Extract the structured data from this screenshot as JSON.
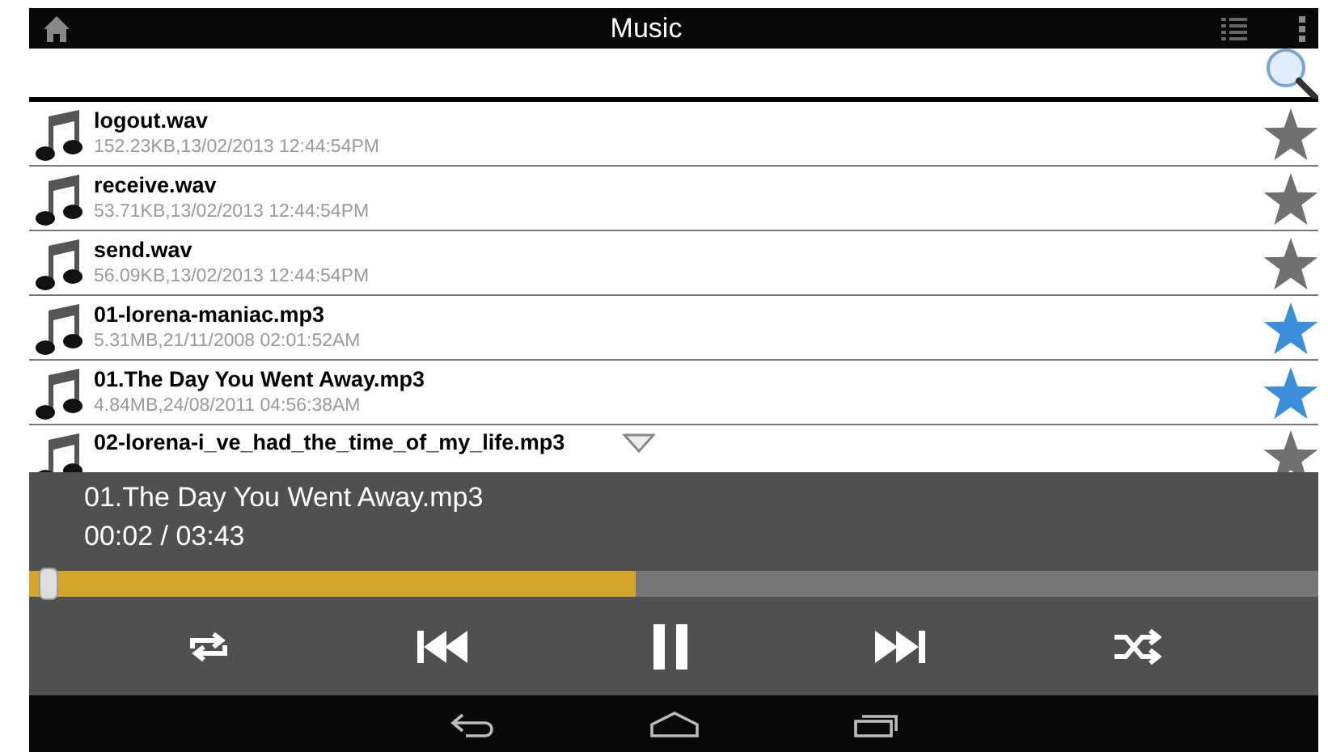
{
  "window": {
    "title": "Music"
  },
  "files": [
    {
      "title": "logout.wav",
      "details": "152.23KB,13/02/2013 12:44:54PM",
      "favorite": false,
      "collapse_handle": false
    },
    {
      "title": "receive.wav",
      "details": "53.71KB,13/02/2013 12:44:54PM",
      "favorite": false,
      "collapse_handle": false
    },
    {
      "title": "send.wav",
      "details": "56.09KB,13/02/2013 12:44:54PM",
      "favorite": false,
      "collapse_handle": false
    },
    {
      "title": "01-lorena-maniac.mp3",
      "details": "5.31MB,21/11/2008 02:01:52AM",
      "favorite": true,
      "collapse_handle": false
    },
    {
      "title": "01.The Day You Went Away.mp3",
      "details": "4.84MB,24/08/2011 04:56:38AM",
      "favorite": true,
      "collapse_handle": false
    },
    {
      "title": "02-lorena-i_ve_had_the_time_of_my_life.mp3",
      "favorite": false,
      "collapse_handle": true
    }
  ],
  "player": {
    "track": "01.The Day You Went Away.mp3",
    "time": "00:02 / 03:43",
    "level": 0.47
  }
}
